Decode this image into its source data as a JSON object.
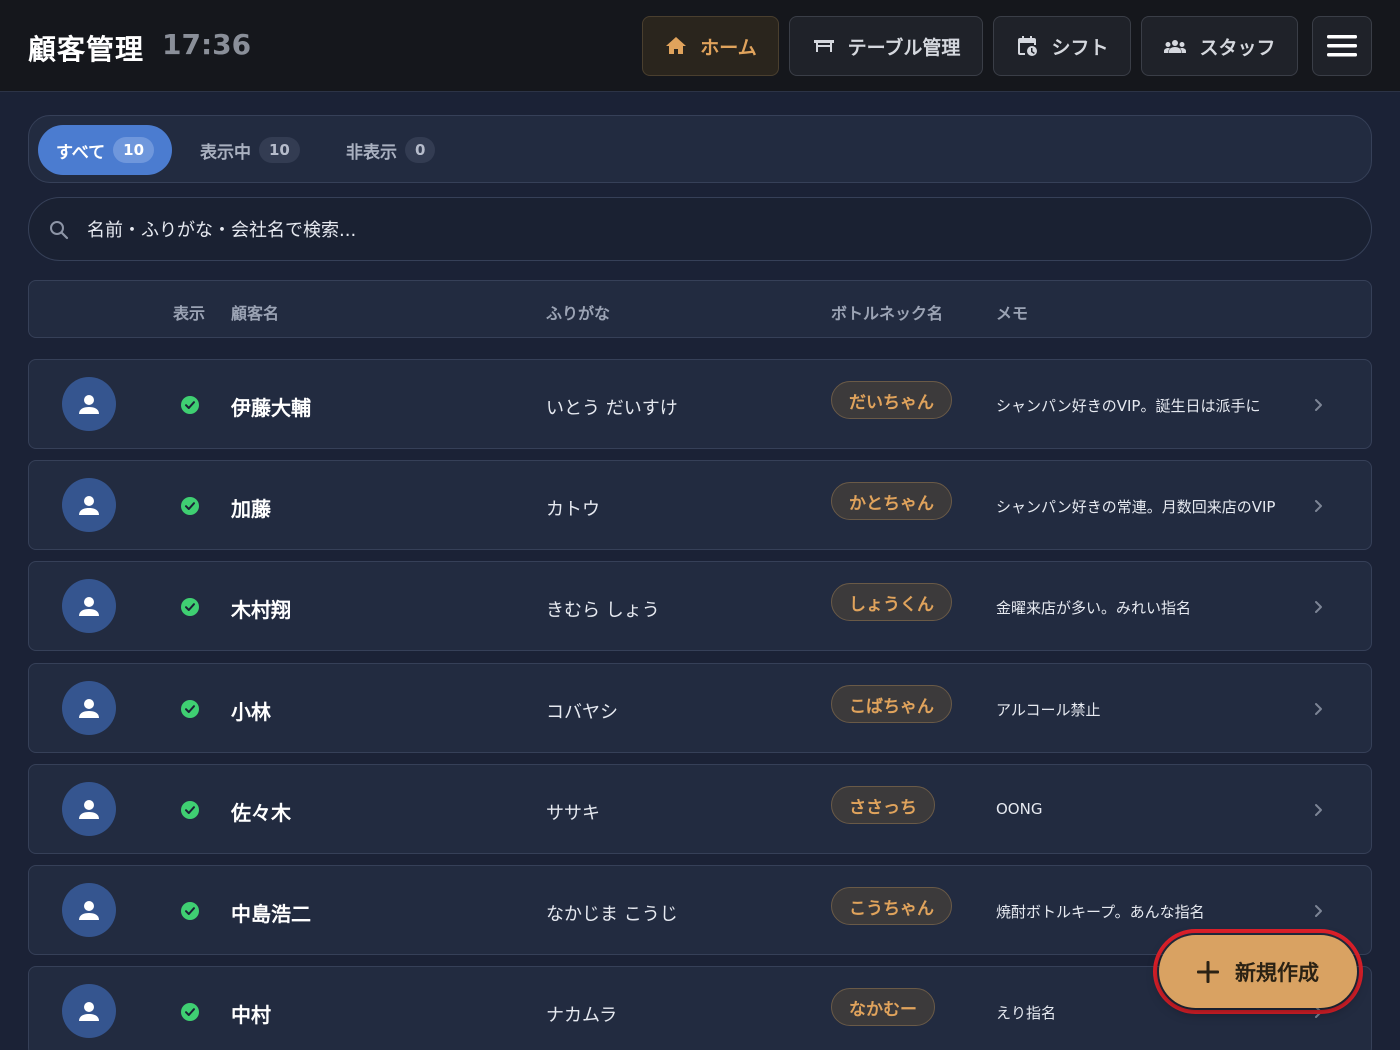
{
  "header": {
    "title": "顧客管理",
    "time": "17:36",
    "nav": [
      {
        "label": "ホーム",
        "icon": "home-icon",
        "active": true
      },
      {
        "label": "テーブル管理",
        "icon": "table-icon",
        "active": false
      },
      {
        "label": "シフト",
        "icon": "calendar-clock-icon",
        "active": false
      },
      {
        "label": "スタッフ",
        "icon": "people-icon",
        "active": false
      }
    ],
    "menu_icon": "hamburger-menu-icon"
  },
  "filter_tabs": [
    {
      "label": "すべて",
      "count": "10",
      "active": true
    },
    {
      "label": "表示中",
      "count": "10",
      "active": false
    },
    {
      "label": "非表示",
      "count": "0",
      "active": false
    }
  ],
  "search": {
    "placeholder": "名前・ふりがな・会社名で検索...",
    "value": ""
  },
  "table": {
    "columns": [
      "表示",
      "顧客名",
      "ふりがな",
      "ボトルネック名",
      "メモ"
    ],
    "rows": [
      {
        "name": "伊藤大輔",
        "furigana": "いとう だいすけ",
        "nickname": "だいちゃん",
        "memo": "シャンパン好きのVIP。誕生日は派手に",
        "visible": true
      },
      {
        "name": "加藤",
        "furigana": "カトウ",
        "nickname": "かとちゃん",
        "memo": "シャンパン好きの常連。月数回来店のVIP",
        "visible": true
      },
      {
        "name": "木村翔",
        "furigana": "きむら しょう",
        "nickname": "しょうくん",
        "memo": "金曜来店が多い。みれい指名",
        "visible": true
      },
      {
        "name": "小林",
        "furigana": "コバヤシ",
        "nickname": "こばちゃん",
        "memo": "アルコール禁止",
        "visible": true
      },
      {
        "name": "佐々木",
        "furigana": "ササキ",
        "nickname": "ささっち",
        "memo": "OONG",
        "visible": true
      },
      {
        "name": "中島浩二",
        "furigana": "なかじま こうじ",
        "nickname": "こうちゃん",
        "memo": "焼酎ボトルキープ。あんな指名",
        "visible": true
      },
      {
        "name": "中村",
        "furigana": "ナカムラ",
        "nickname": "なかむー",
        "memo": "えり指名",
        "visible": true
      }
    ]
  },
  "fab": {
    "label": "新規作成",
    "icon": "plus-icon"
  },
  "colors": {
    "background": "#1b2236",
    "accent": "#e0a35c",
    "active_tab": "#4b7cd0",
    "visible_check": "#3fcf72",
    "highlight_ring": "#e0202a"
  }
}
